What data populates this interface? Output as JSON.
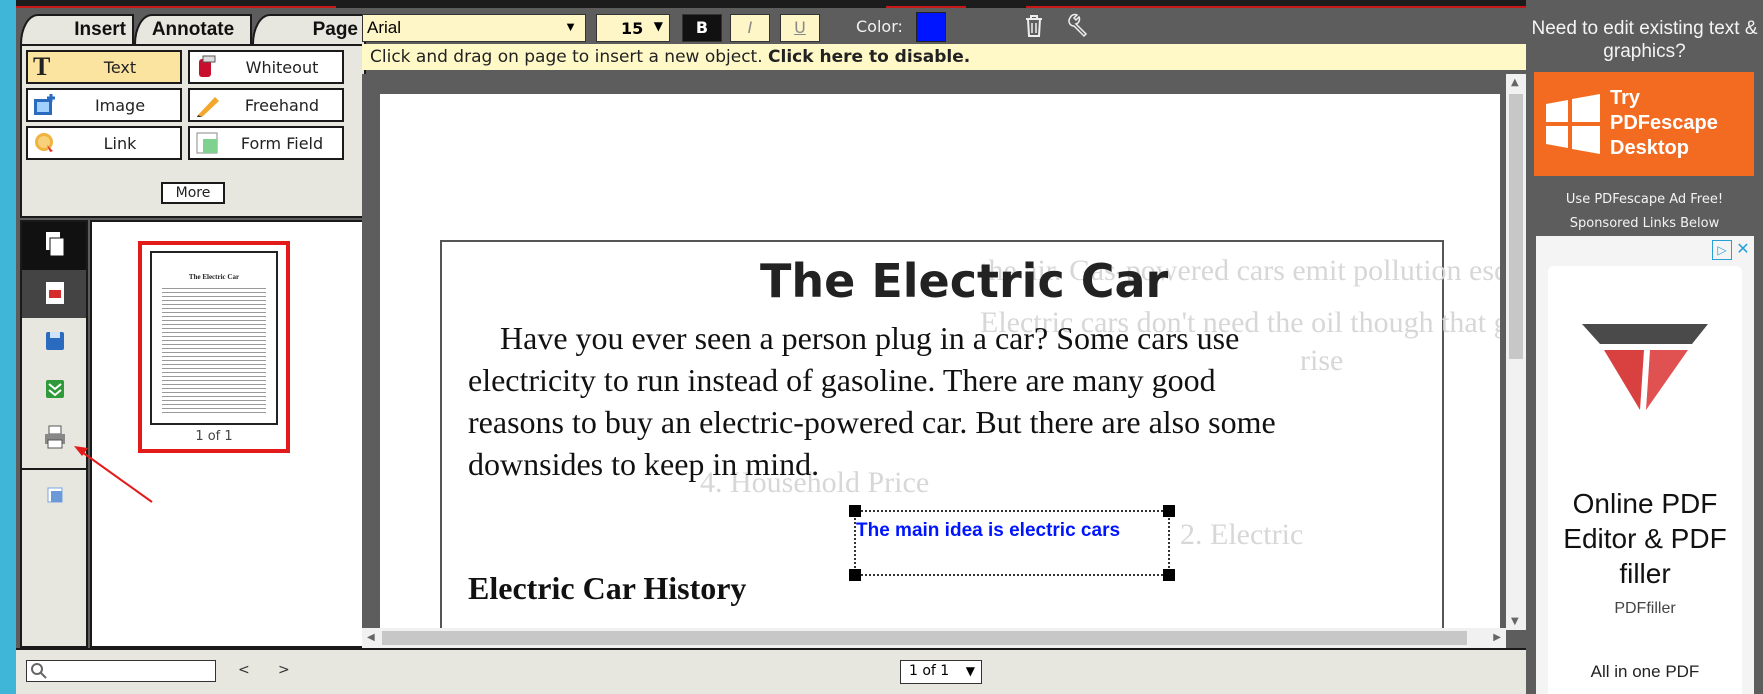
{
  "tabs": [
    {
      "label": "Insert"
    },
    {
      "label": "Annotate"
    },
    {
      "label": "Page"
    }
  ],
  "tools": {
    "text": "Text",
    "whiteout": "Whiteout",
    "image": "Image",
    "freehand": "Freehand",
    "link": "Link",
    "form_field": "Form Field",
    "more": "More"
  },
  "toolbar": {
    "font": "Arial",
    "size": "15",
    "bold": "B",
    "italic": "I",
    "underline": "U",
    "color_label": "Color:",
    "color_value": "#0015ff"
  },
  "hint": {
    "text": "Click and drag on page to insert a new object.",
    "link": "Click here to disable."
  },
  "document": {
    "title": "The Electric Car",
    "paragraph": [
      "Have you ever seen a person plug in a car? Some cars use",
      "electricity to run instead of gasoline. There are many good",
      "reasons to buy an electric-powered car. But there are also some",
      "downsides to keep in mind."
    ],
    "heading": "Electric Car History",
    "inserted_text": "The main idea is electric cars",
    "ghost_lines": [
      "the air. Gas-powered cars emit pollution escape",
      "Electric cars don't need the oil though that gas cars need. No oil",
      "rise",
      "4. Household Price",
      "2. Electric"
    ]
  },
  "thumbnail": {
    "label": "1 of 1",
    "title": "The Electric Car"
  },
  "bottom": {
    "prev": "<",
    "next": ">",
    "page_select": "1 of 1"
  },
  "ad": {
    "top_text": "Need to edit existing text & graphics?",
    "try_line1": "Try",
    "try_line2": "PDFescape",
    "try_line3": "Desktop",
    "ad_free": "Use PDFescape Ad Free!",
    "sponsored": "Sponsored Links Below",
    "title": "Online PDF Editor & PDF filler",
    "brand": "PDFfiller",
    "sub": "All in one PDF"
  },
  "colors": {
    "accent_orange": "#f26b21",
    "text_blue": "#0015ff",
    "highlight_red": "#e41b1b"
  }
}
